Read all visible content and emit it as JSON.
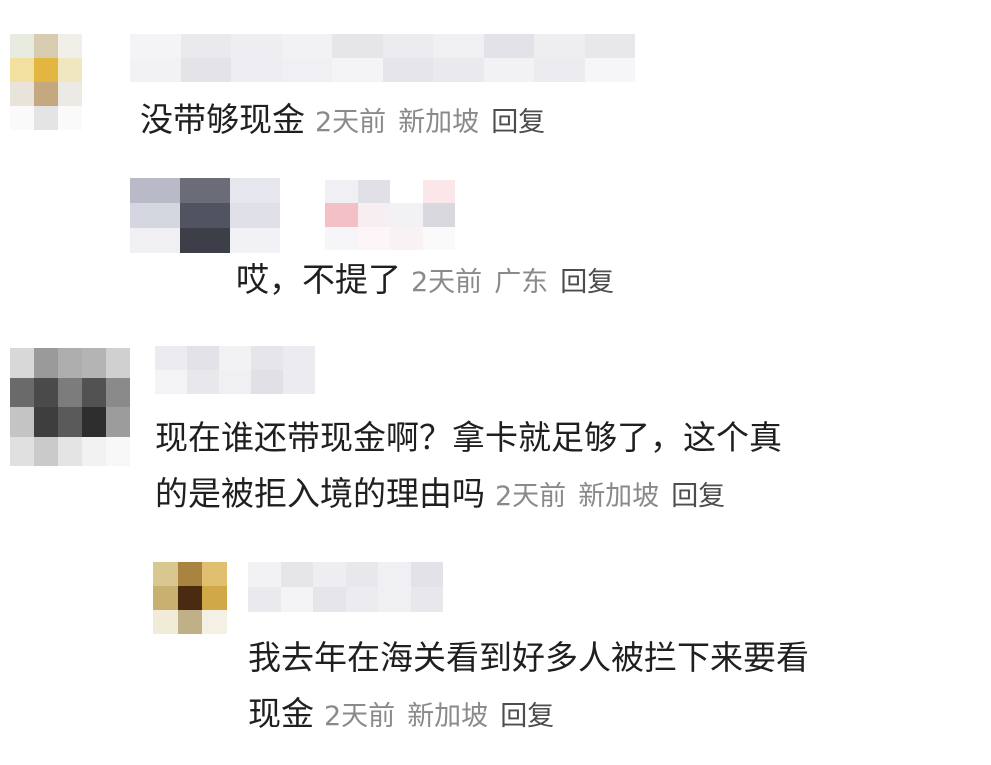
{
  "comments": [
    {
      "text": "没带够现金",
      "time": "2天前",
      "location": "新加坡",
      "reply": "回复",
      "avatar_colors": [
        "#e8ece0",
        "#d8ccb0",
        "#f0f0e8",
        "#f2e0a0",
        "#e2b640",
        "#f0e6c0",
        "#e8e4dc",
        "#c4a880",
        "#eceae4",
        "#fafafa",
        "#e4e4e4",
        "#fafafa"
      ],
      "name_colors": [
        "#f4f4f6",
        "#eaeaee",
        "#eeeef2",
        "#f2f2f4",
        "#e6e6ea",
        "#ececf0",
        "#f0f0f2",
        "#e2e2e8",
        "#eeeef0",
        "#e8e8ec",
        "#f2f2f4",
        "#e4e4e8",
        "#eeeef2",
        "#f0f0f4",
        "#f4f4f6",
        "#e6e6ea",
        "#eaeaee",
        "#f2f2f4",
        "#ececf0",
        "#f6f6f8"
      ]
    },
    {
      "text": "哎，不提了",
      "time": "2天前",
      "location": "广东",
      "reply": "回复",
      "avatar_colors": [
        "#b8bac8",
        "#6a6c78",
        "#e6e6ee",
        "#d4d6e0",
        "#505460",
        "#e0e0e8",
        "#f0f0f4",
        "#3c3e48",
        "#f2f2f6"
      ],
      "name_colors": [
        "#f0f0f4",
        "#e0e0e6",
        "#ffffff",
        "#fbe6ea",
        "#f4c0c8",
        "#f6eef0",
        "#f2f2f4",
        "#d8d8de",
        "#f6f6f8",
        "#fdf6f8",
        "#f8f2f4",
        "#fafafa"
      ]
    },
    {
      "text_lines": [
        "现在谁还带现金啊？拿卡就足够了，这个真",
        "的是被拒入境的理由吗"
      ],
      "time": "2天前",
      "location": "新加坡",
      "reply": "回复",
      "avatar_colors": [
        "#d8d8d8",
        "#9a9a9a",
        "#aeaeae",
        "#b4b4b4",
        "#d0d0d0",
        "#6a6a6a",
        "#4a4a4a",
        "#7c7c7c",
        "#525252",
        "#8a8a8a",
        "#c4c4c4",
        "#3e3e3e",
        "#5a5a5a",
        "#2e2e2e",
        "#9c9c9c",
        "#e0e0e0",
        "#cacaca",
        "#e4e4e4",
        "#f2f2f2",
        "#f8f8f8"
      ],
      "name_colors": [
        "#ececf0",
        "#e2e2e8",
        "#f2f2f4",
        "#e6e6ea",
        "#ececf0",
        "#f4f4f6",
        "#e8e8ec",
        "#f0f0f2",
        "#e0e0e6",
        "#ececf0"
      ]
    },
    {
      "text_lines": [
        "我去年在海关看到好多人被拦下来要看",
        "现金"
      ],
      "time": "2天前",
      "location": "新加坡",
      "reply": "回复",
      "avatar_colors": [
        "#d8c890",
        "#a88440",
        "#e0c070",
        "#c8b070",
        "#4a2a10",
        "#d0a848",
        "#f0ecd8",
        "#c0b088",
        "#f4f0e4"
      ],
      "name_colors": [
        "#f2f2f4",
        "#e6e6ea",
        "#eeeef2",
        "#e8e8ec",
        "#f0f0f4",
        "#e2e2e8",
        "#eaeaee",
        "#f4f4f6",
        "#e6e6ea",
        "#ececf0",
        "#f0f0f2",
        "#e8e8ec"
      ]
    }
  ]
}
